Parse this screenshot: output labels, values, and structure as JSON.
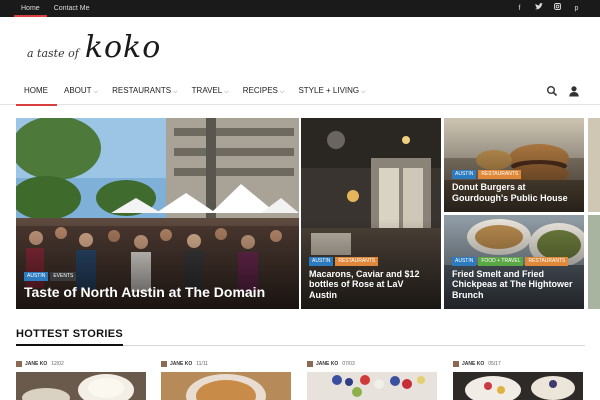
{
  "topbar": {
    "links": [
      {
        "label": "Home",
        "active": true
      },
      {
        "label": "Contact Me",
        "active": false
      }
    ],
    "social": [
      "facebook-icon",
      "twitter-icon",
      "instagram-icon",
      "pinterest-icon"
    ]
  },
  "logo": {
    "small": "a taste of",
    "big": "koko"
  },
  "nav": {
    "items": [
      {
        "label": "HOME",
        "active": true,
        "dropdown": false
      },
      {
        "label": "ABOUT",
        "dropdown": true
      },
      {
        "label": "RESTAURANTS",
        "dropdown": true
      },
      {
        "label": "TRAVEL",
        "dropdown": true
      },
      {
        "label": "RECIPES",
        "dropdown": true
      },
      {
        "label": "STYLE + LIVING",
        "dropdown": true
      }
    ],
    "icons": [
      "search-icon",
      "user-icon"
    ]
  },
  "featured": [
    {
      "tags": [
        "AUSTIN",
        "EVENTS"
      ],
      "title": "Taste of North Austin at The Domain"
    },
    {
      "tags": [
        "AUSTIN",
        "RESTAURANTS"
      ],
      "title": "Macarons, Caviar and $12 bottles of Rose at LaV Austin"
    },
    {
      "tags": [
        "AUSTIN",
        "RESTAURANTS"
      ],
      "title": "Donut Burgers at Gourdough's Public House"
    },
    {
      "tags": [
        "AUSTIN",
        "FOOD + TRAVEL",
        "RESTAURANTS"
      ],
      "title": "Fried Smelt and Fried Chickpeas at The Hightower Brunch"
    }
  ],
  "section": {
    "title": "HOTTEST STORIES"
  },
  "stories": [
    {
      "author": "JANE KO",
      "date": "12/02"
    },
    {
      "author": "JANE KO",
      "date": "11/11"
    },
    {
      "author": "JANE KO",
      "date": "07/03"
    },
    {
      "author": "JANE KO",
      "date": "05/17"
    }
  ],
  "colors": {
    "accent": "#d84040",
    "topbar": "#1a1a1a",
    "tag_blue": "#2d7bbf",
    "tag_orange": "#e0883a",
    "tag_green": "#5aa845"
  }
}
